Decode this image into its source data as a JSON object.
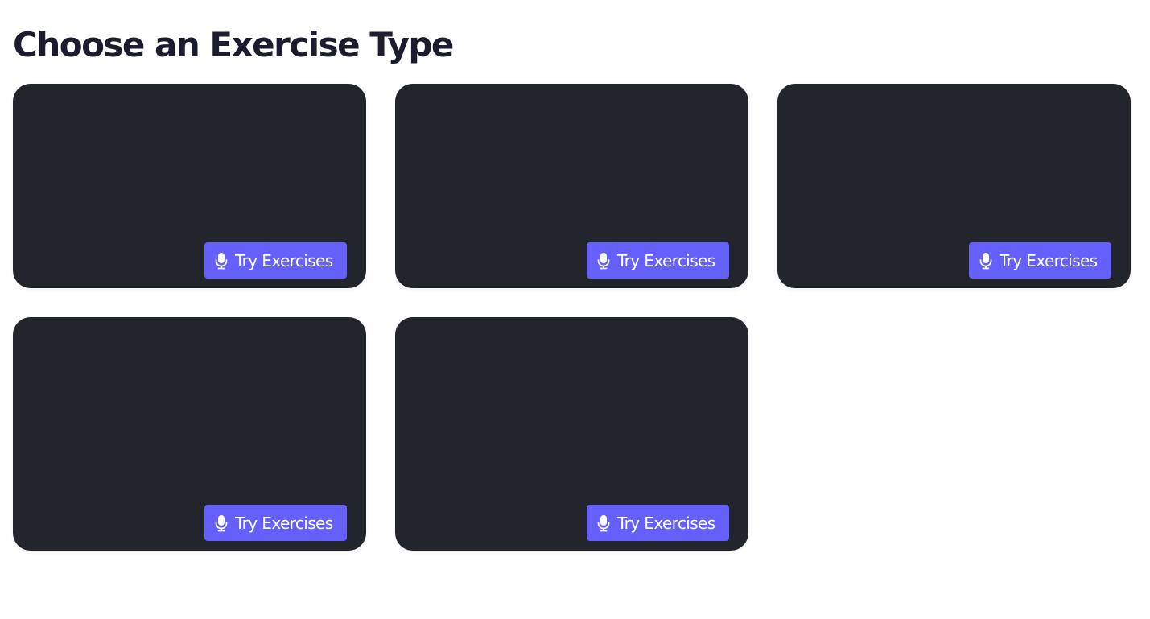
{
  "header": {
    "title": "Choose an Exercise Type"
  },
  "cards": [
    {
      "button_label": "Try Exercises",
      "button_icon": "microphone-icon"
    },
    {
      "button_label": "Try Exercises",
      "button_icon": "microphone-icon"
    },
    {
      "button_label": "Try Exercises",
      "button_icon": "microphone-icon"
    },
    {
      "button_label": "Try Exercises",
      "button_icon": "microphone-icon"
    },
    {
      "button_label": "Try Exercises",
      "button_icon": "microphone-icon"
    }
  ],
  "next_section": {
    "title": ""
  },
  "colors": {
    "card_background": "#22252b",
    "accent": "#6560fb",
    "heading": "#1b1d2e",
    "page_background": "#ffffff"
  }
}
